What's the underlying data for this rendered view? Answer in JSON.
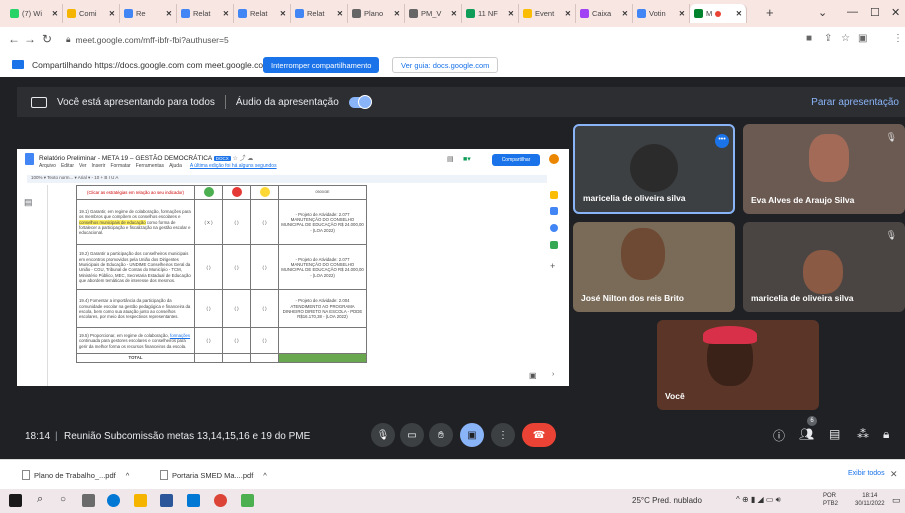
{
  "browser": {
    "tabs": [
      {
        "label": "(7) Wi",
        "color": "#25d366"
      },
      {
        "label": "Comi",
        "color": "#f4b400"
      },
      {
        "label": "Re",
        "color": "#4285f4"
      },
      {
        "label": "Relat",
        "color": "#4285f4"
      },
      {
        "label": "Relat",
        "color": "#4285f4"
      },
      {
        "label": "Relat",
        "color": "#4285f4"
      },
      {
        "label": "Plano",
        "color": "#666666"
      },
      {
        "label": "PM_V",
        "color": "#666666"
      },
      {
        "label": "11 NF",
        "color": "#0f9d58"
      },
      {
        "label": "Event",
        "color": "#fbbc04"
      },
      {
        "label": "Caixa",
        "color": "#a142f4"
      },
      {
        "label": "Votin",
        "color": "#4285f4"
      },
      {
        "label": "M",
        "color": "#00832d"
      }
    ],
    "url": "meet.google.com/mff-ibfr-fbi?authuser=5",
    "colors": {
      "tab_strip": "#f8e6e3",
      "accent": "#1a73e8"
    }
  },
  "sharebar": {
    "text": "Compartilhando https://docs.google.com com meet.google.com",
    "stop_button": "Interromper compartilhamento",
    "view_button": "Ver guia: docs.google.com"
  },
  "presentation": {
    "status": "Você está apresentando para todos",
    "audio": "Áudio da apresentação",
    "stop": "Parar apresentação"
  },
  "doc": {
    "title": "Relatório Preliminar - META 19 – GESTÃO DEMOCRÁTICA",
    "badge": "DOCX",
    "menu": [
      "Arquivo",
      "Editar",
      "Ver",
      "Inserir",
      "Formatar",
      "Ferramentas",
      "Ajuda"
    ],
    "last_edit": "A última edição foi há alguns segundos",
    "share": "Compartilhar",
    "toolbar": "100%  ▾   Texto norm...  ▾   Arial   ▾   -  10  +   B  I  U  A",
    "header_note": "(Clicar as estratégias em relação ao seu indicador)",
    "header_code": "0500/3E",
    "rows": [
      {
        "strategy_prefix": "19.1) Garantir, em regime de colaboração, formações para os membros que compõem os conselhos escolares e ",
        "strategy_highlight": "conselhos municipais de educação",
        "strategy_suffix": " como forma de fortalecer a participação e fiscalização na gestão escolar e educacional.",
        "c1": "( X )",
        "c2": "(  )",
        "c3": "(  )",
        "action": "- Projeto de Atividade: 2.077 MANUTENÇÃO DO CONSELHO MUNICIPAL DE EDUCAÇÃO R$ 24.000,00 - (LOA 2022)"
      },
      {
        "strategy": "19.2) Garantir a participação dos conselheiros municipais em encontros promovidos pela União dos Dirigentes Municipais de Educação - UNDIME Conselheiros Geral da União - CGU, Tribunal de Contas do Município - TCM, Ministério Público, MEC, Secretaria Estadual de Educação que abordem temáticas de interesse dos mesmos.",
        "c1": "(  )",
        "c2": "(  )",
        "c3": "(  )",
        "action": "- Projeto de Atividade: 2.077 MANUTENÇÃO DO CONSELHO MUNICIPAL DE EDUCAÇÃO R$ 24.000,00 - (LOA 2022)"
      },
      {
        "strategy": "19.4) Fomentar a importância da participação da comunidade escolar na gestão pedagógica e financeira da escola, bem como sua atuação junto ao conselhos escolares, por meio dos respectivos representantes.",
        "c1": "(  )",
        "c2": "(  )",
        "c3": "(  )",
        "action": "- Projeto de Atividade: 2.004 ATENDIMENTO AO PROGRAMA DINHEIRO DIRETO NA ESCOLA - PDDE R$16.170,38 - (LOA 2022)"
      },
      {
        "strategy_prefix": "19.5) Proporcionar, em regime de colaboração, ",
        "strategy_link": "formações",
        "strategy_suffix": " continuada para gestores escolares e conselheiros para gerir da melhor forma os recursos financeiros da escola.",
        "c1": "(  )",
        "c2": "(  )",
        "c3": "(  )",
        "action": ""
      }
    ],
    "total": "TOTAL"
  },
  "participants": [
    {
      "name": "maricelia de oliveira silva"
    },
    {
      "name": "Eva Alves de Araujo Silva"
    },
    {
      "name": "José Nilton dos reis Brito"
    },
    {
      "name": "maricelia de oliveira silva"
    },
    {
      "name": "Você"
    }
  ],
  "meeting": {
    "time": "18:14",
    "title": "Reunião Subcomissão metas 13,14,15,16 e 19 do PME",
    "participant_count": "6"
  },
  "downloads": {
    "items": [
      "Plano de Trabalho_...pdf",
      "Portaria SMED Ma....pdf"
    ],
    "show_all": "Exibir todos"
  },
  "taskbar": {
    "weather": "25°C  Pred. nublado",
    "lang_1": "POR",
    "lang_2": "PTB2",
    "clock_time": "18:14",
    "clock_date": "30/11/2022"
  }
}
